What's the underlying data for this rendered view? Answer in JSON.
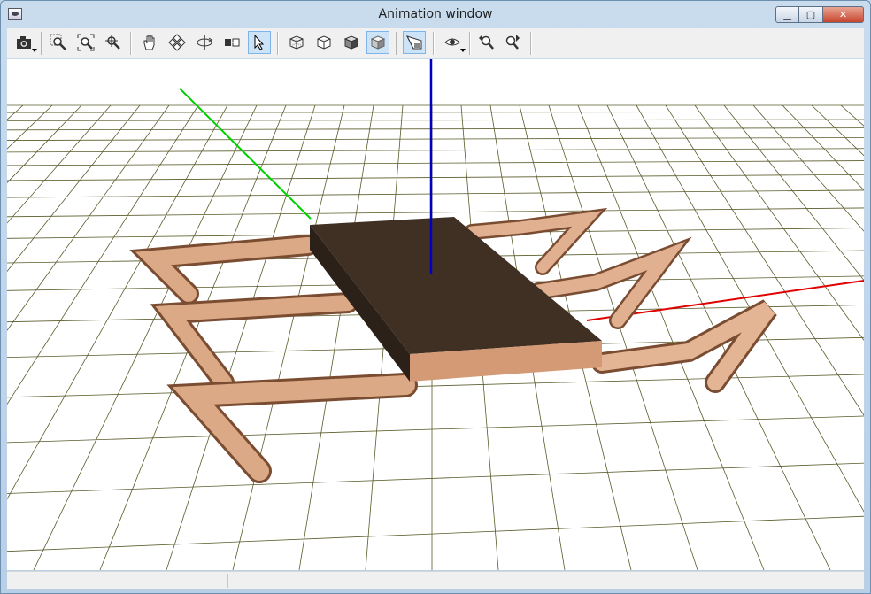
{
  "window": {
    "title": "Animation window"
  },
  "title_controls": {
    "minimize_icon": "minimize-icon",
    "maximize_icon": "maximize-icon",
    "close_icon": "close-icon"
  },
  "toolbar": {
    "tools": [
      {
        "name": "camera-snapshot-button",
        "icon": "camera-icon"
      },
      {
        "name": "zoom-rect-button",
        "icon": "zoom-rect-icon"
      },
      {
        "name": "zoom-fit-button",
        "icon": "zoom-fit-icon"
      },
      {
        "name": "zoom-center-button",
        "icon": "zoom-center-icon"
      },
      {
        "name": "pan-button",
        "icon": "hand-icon"
      },
      {
        "name": "rotate-button",
        "icon": "rotate-icon"
      },
      {
        "name": "orbit-button",
        "icon": "orbit-icon"
      },
      {
        "name": "fit-width-button",
        "icon": "fit-width-icon"
      },
      {
        "name": "select-button",
        "icon": "arrow-cursor-icon"
      },
      {
        "name": "wireframe-view-button",
        "icon": "wireframe-cube-icon"
      },
      {
        "name": "hidden-line-view-button",
        "icon": "hidden-line-cube-icon"
      },
      {
        "name": "flat-shaded-view-button",
        "icon": "flat-cube-icon"
      },
      {
        "name": "smooth-shaded-view-button",
        "icon": "shaded-cube-icon"
      },
      {
        "name": "perspective-button",
        "icon": "perspective-icon"
      },
      {
        "name": "view-options-button",
        "icon": "eye-icon"
      },
      {
        "name": "previous-view-button",
        "icon": "zoom-back-icon"
      },
      {
        "name": "next-view-button",
        "icon": "zoom-forward-icon"
      }
    ]
  },
  "colors": {
    "x_axis": "#e00000",
    "y_axis": "#00d000",
    "z_axis": "#0000c0",
    "grid": "#5a5a2a",
    "body_top": "#3f3023",
    "limb": "#d9a47f"
  },
  "statusbar": {
    "pane1": "",
    "pane2": ""
  }
}
